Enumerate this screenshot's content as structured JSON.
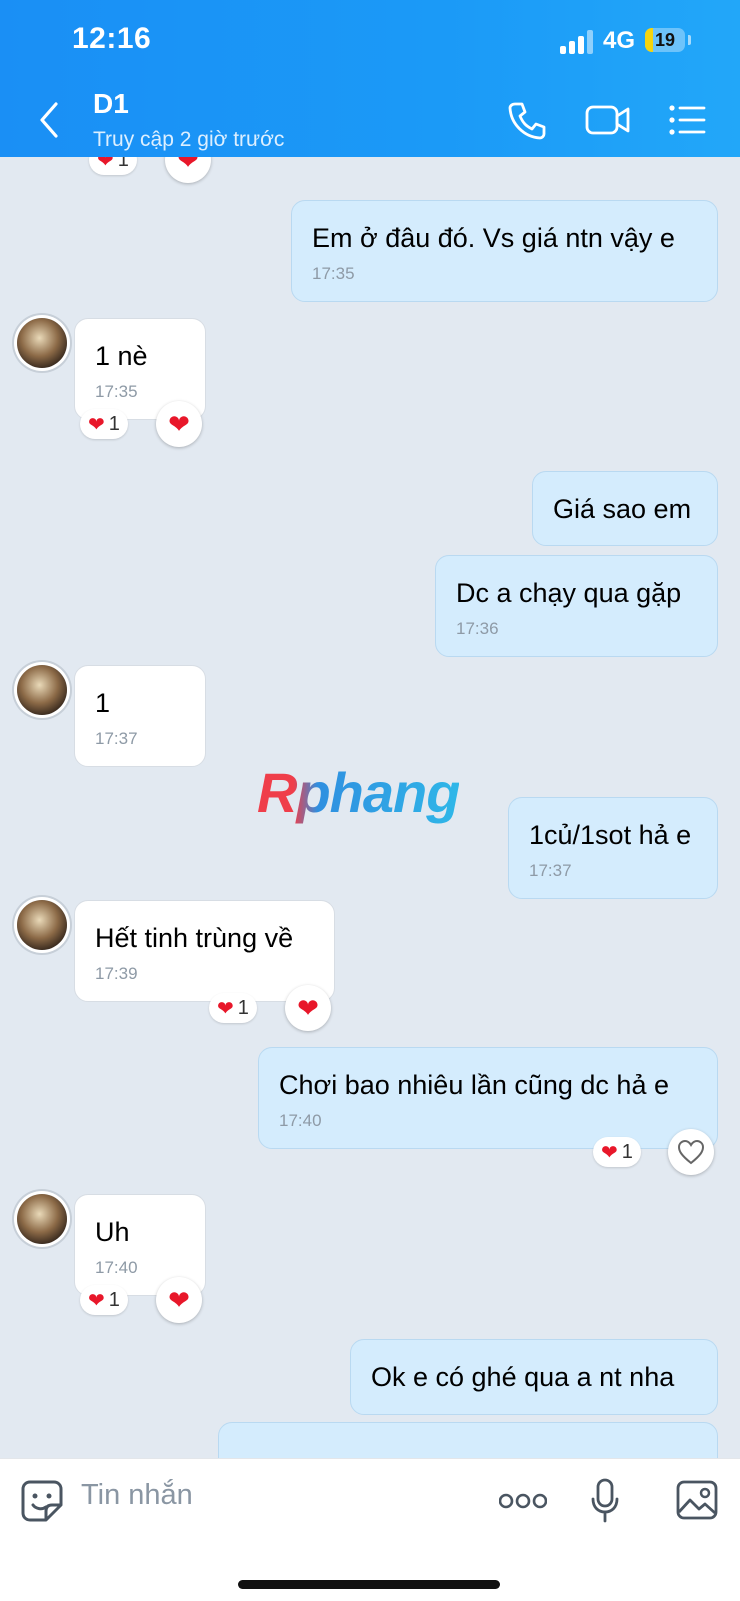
{
  "status_bar": {
    "time": "12:16",
    "network": "4G",
    "battery": "19",
    "battery_level": 0.19
  },
  "header": {
    "contact_name": "D1",
    "contact_status": "Truy cập 2 giờ trước",
    "icons": [
      "back-chevron-icon",
      "phone-icon",
      "video-call-icon",
      "menu-list-icon"
    ]
  },
  "colors": {
    "header_bg": "#1b9af7",
    "chat_bg": "#e2e9f1",
    "outgoing_bubble": "#d4ecfd",
    "incoming_bubble": "#ffffff",
    "heart": "#e8172a"
  },
  "messages": [
    {
      "dir": "out",
      "text": "Em ở đâu đó. Vs giá ntn vậy e",
      "time": "17:35"
    },
    {
      "dir": "in",
      "text": "1 nè",
      "time": "17:35",
      "reaction_count": "1"
    },
    {
      "dir": "out",
      "text": "Giá sao em"
    },
    {
      "dir": "out",
      "text": "Dc a chạy qua gặp",
      "time": "17:36"
    },
    {
      "dir": "in",
      "text": "1",
      "time": "17:37"
    },
    {
      "dir": "out",
      "text": "1củ/1sot hả e",
      "time": "17:37"
    },
    {
      "dir": "in",
      "text": "Hết tinh trùng về",
      "time": "17:39",
      "reaction_count": "1"
    },
    {
      "dir": "out",
      "text": "Chơi bao nhiêu lần cũng dc hả e",
      "time": "17:40",
      "reaction_count": "1"
    },
    {
      "dir": "in",
      "text": "Uh",
      "time": "17:40",
      "reaction_count": "1"
    },
    {
      "dir": "out",
      "text": "Ok e có ghé qua a nt nha"
    }
  ],
  "top_partial_reaction_count": "1",
  "watermark": "Rphang",
  "input": {
    "placeholder": "Tin nhắn",
    "icons": [
      "sticker-icon",
      "more-options-icon",
      "microphone-icon",
      "image-icon"
    ]
  }
}
